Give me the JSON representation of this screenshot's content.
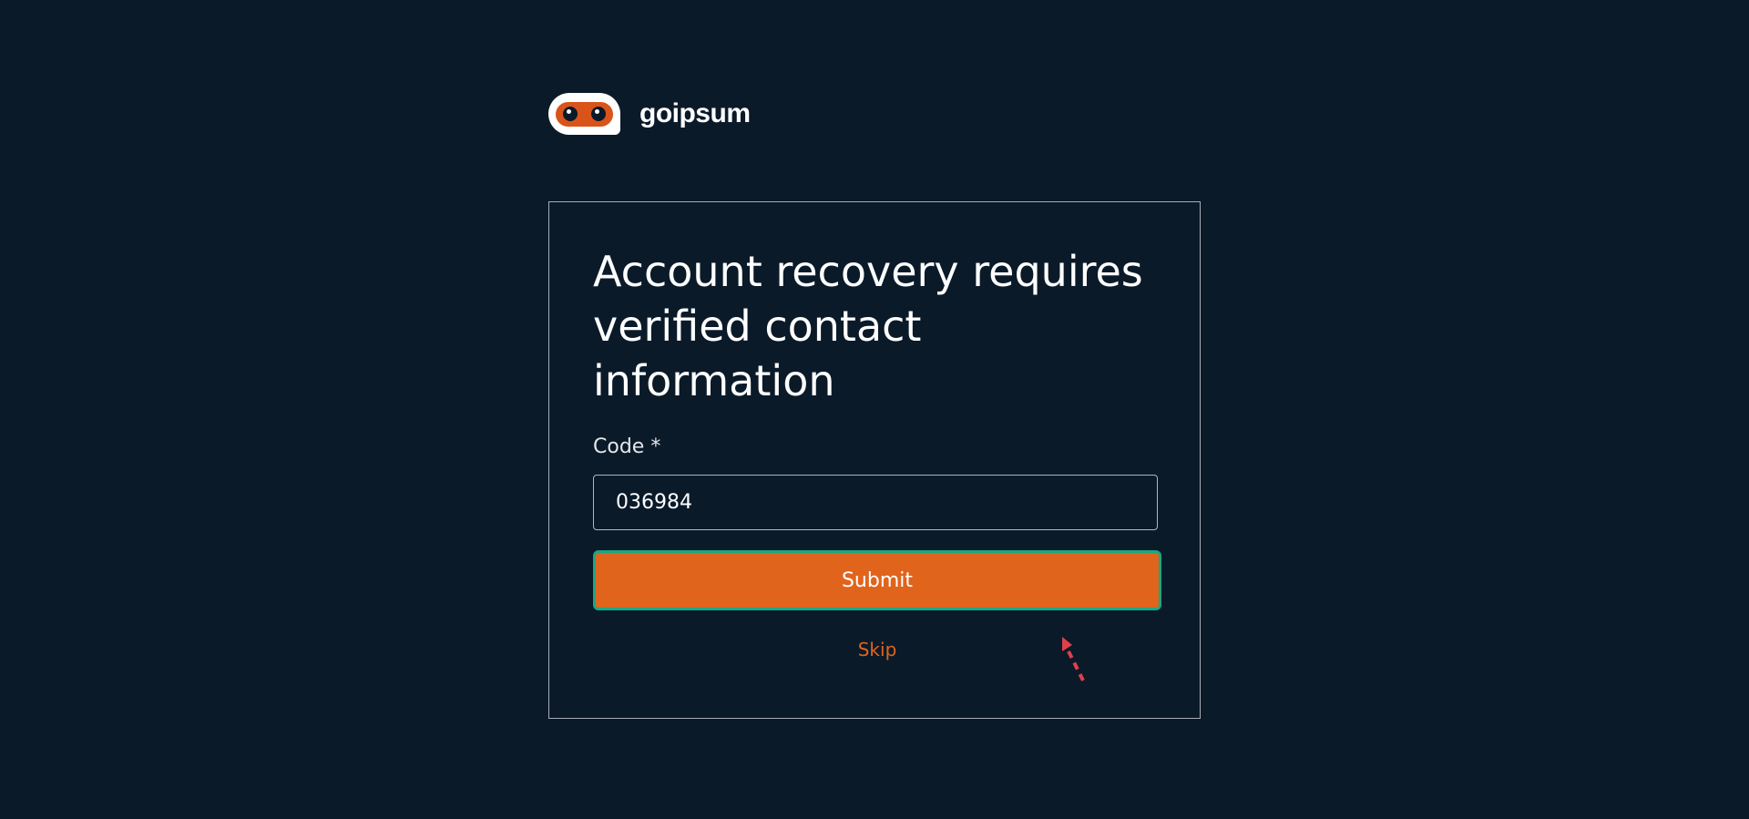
{
  "brand": {
    "name": "goipsum",
    "logo_icon": "goipsum-logo-icon"
  },
  "form": {
    "title": "Account recovery requires verified contact information",
    "code_label": "Code *",
    "code_value": "036984",
    "submit_label": "Submit",
    "skip_label": "Skip"
  },
  "colors": {
    "background": "#0b1a29",
    "accent": "#e0641c",
    "focus_ring": "#1aa882",
    "cursor": "#e0404a"
  },
  "cursor_icon": "dashed-arrow-cursor-icon"
}
